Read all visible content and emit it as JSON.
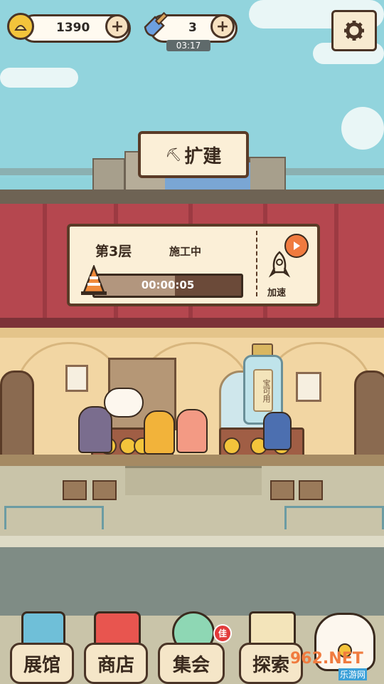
{
  "topbar": {
    "coins": "1390",
    "shovels": "3",
    "shovel_timer": "03:17"
  },
  "expand": {
    "label": "扩建"
  },
  "construction": {
    "floor": "第3层",
    "status": "施工中",
    "timer": "00:00:05",
    "progress": 0.55,
    "speed_label": "加速"
  },
  "bottle_note": "宝可用",
  "nav": {
    "items": [
      {
        "label": "展馆"
      },
      {
        "label": "商店"
      },
      {
        "label": "集会"
      },
      {
        "label": "探索"
      }
    ],
    "badge": "佳"
  },
  "watermark": {
    "brand": "962.NET",
    "sub": "乐游网"
  },
  "colors": {
    "awning": "#b5474f",
    "wall": "#f2d6a3",
    "sky": "#92d4dd",
    "coin": "#f3c43b",
    "outline": "#4a3426"
  }
}
